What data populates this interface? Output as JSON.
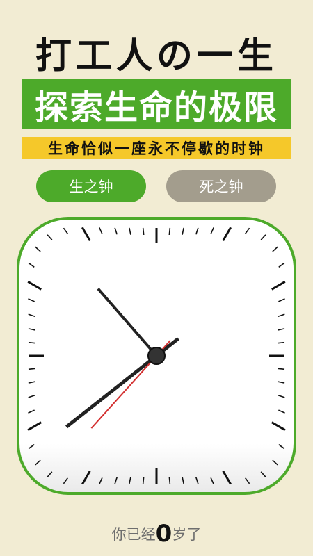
{
  "header": {
    "title": "打工人の一生",
    "banner": "探索生命的极限",
    "ribbon": "生命恰似一座永不停歇的时钟"
  },
  "tabs": [
    {
      "label": "生之钟",
      "active": true
    },
    {
      "label": "死之钟",
      "active": false
    }
  ],
  "clock": {
    "hour": 10,
    "minute": 38,
    "second": 37
  },
  "age": {
    "prefix": "你已经",
    "value": "0",
    "suffix": "岁了"
  },
  "colors": {
    "background": "#f2ecd3",
    "green": "#4daa2a",
    "yellow": "#f5c82a",
    "gray_tab": "#a39d8d",
    "second_hand": "#d32f2f"
  }
}
